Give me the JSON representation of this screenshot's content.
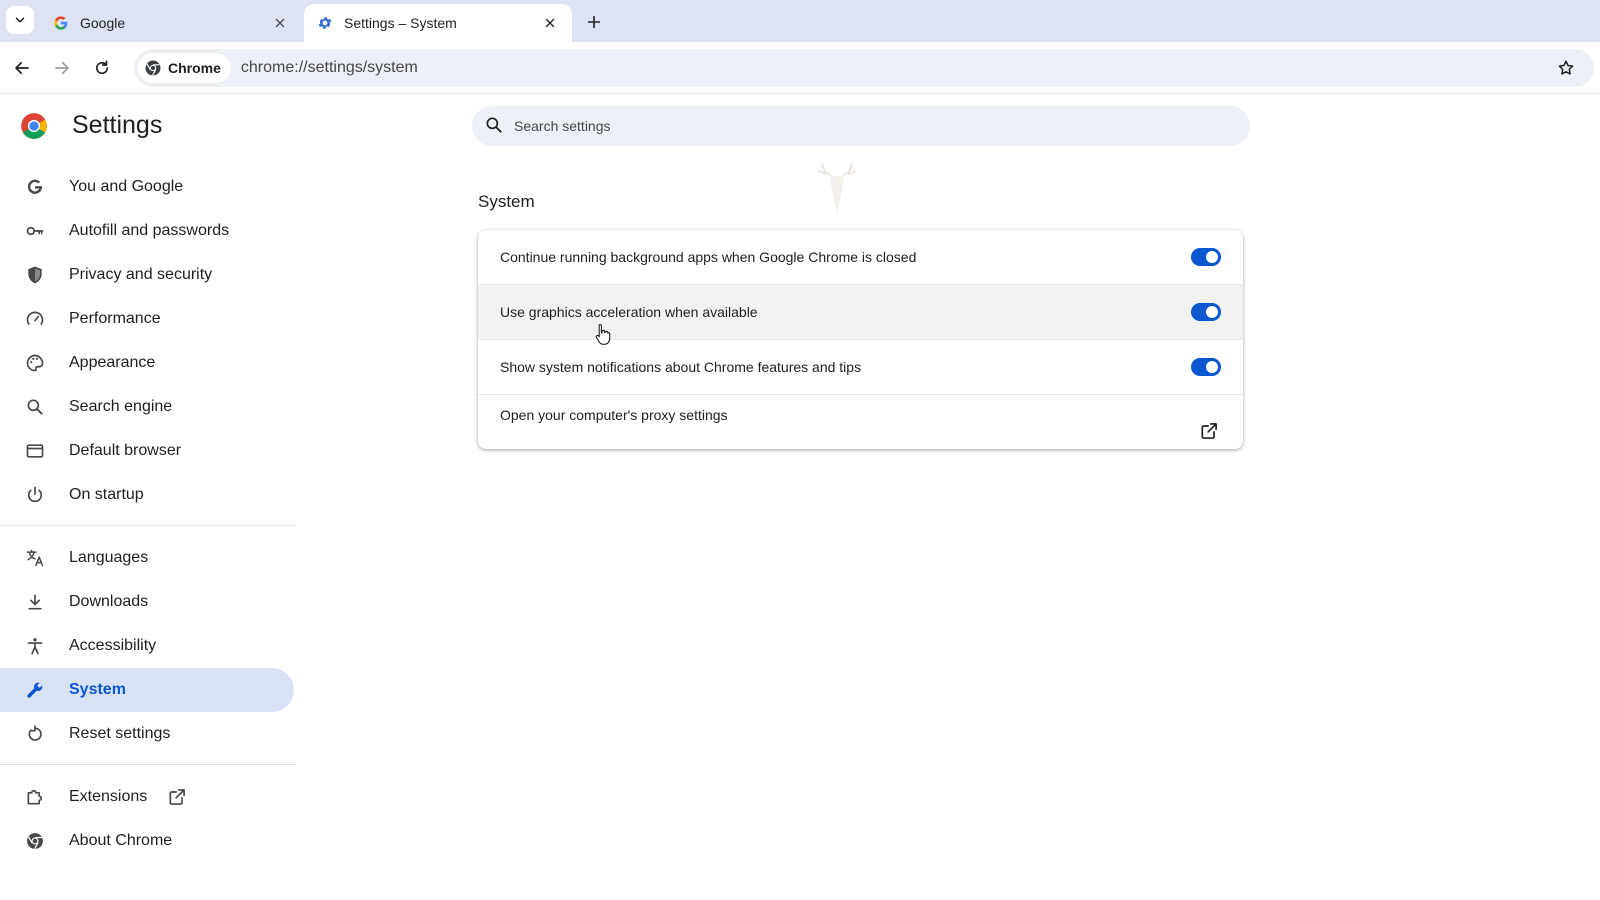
{
  "tabs": [
    {
      "title": "Google",
      "favicon": "google-g-icon",
      "active": false
    },
    {
      "title": "Settings – System",
      "favicon": "gear-icon",
      "active": true
    }
  ],
  "toolbar": {
    "chip_label": "Chrome",
    "url": "chrome://settings/system"
  },
  "sidebar": {
    "title": "Settings",
    "items": [
      {
        "label": "You and Google",
        "icon": "google-g-icon"
      },
      {
        "label": "Autofill and passwords",
        "icon": "key-icon"
      },
      {
        "label": "Privacy and security",
        "icon": "shield-icon"
      },
      {
        "label": "Performance",
        "icon": "speedometer-icon"
      },
      {
        "label": "Appearance",
        "icon": "palette-icon"
      },
      {
        "label": "Search engine",
        "icon": "search-icon"
      },
      {
        "label": "Default browser",
        "icon": "browser-window-icon"
      },
      {
        "label": "On startup",
        "icon": "power-icon"
      },
      {
        "label": "Languages",
        "icon": "translate-icon"
      },
      {
        "label": "Downloads",
        "icon": "download-icon"
      },
      {
        "label": "Accessibility",
        "icon": "accessibility-icon"
      },
      {
        "label": "System",
        "icon": "wrench-icon",
        "selected": true
      },
      {
        "label": "Reset settings",
        "icon": "reset-icon"
      },
      {
        "label": "Extensions",
        "icon": "puzzle-icon"
      },
      {
        "label": "About Chrome",
        "icon": "chrome-icon"
      }
    ]
  },
  "search": {
    "placeholder": "Search settings"
  },
  "main": {
    "section_title": "System",
    "rows": [
      {
        "label": "Continue running background apps when Google Chrome is closed",
        "control": "toggle",
        "on": true
      },
      {
        "label": "Use graphics acceleration when available",
        "control": "toggle",
        "on": true
      },
      {
        "label": "Show system notifications about Chrome features and tips",
        "control": "toggle",
        "on": true
      },
      {
        "label": "Open your computer's proxy settings",
        "control": "external-link"
      }
    ]
  },
  "colors": {
    "accent": "#0b57d0",
    "tabstrip": "#dde3f3",
    "selected_bg": "#d9e1f6",
    "omnibox": "#eef0f7"
  }
}
